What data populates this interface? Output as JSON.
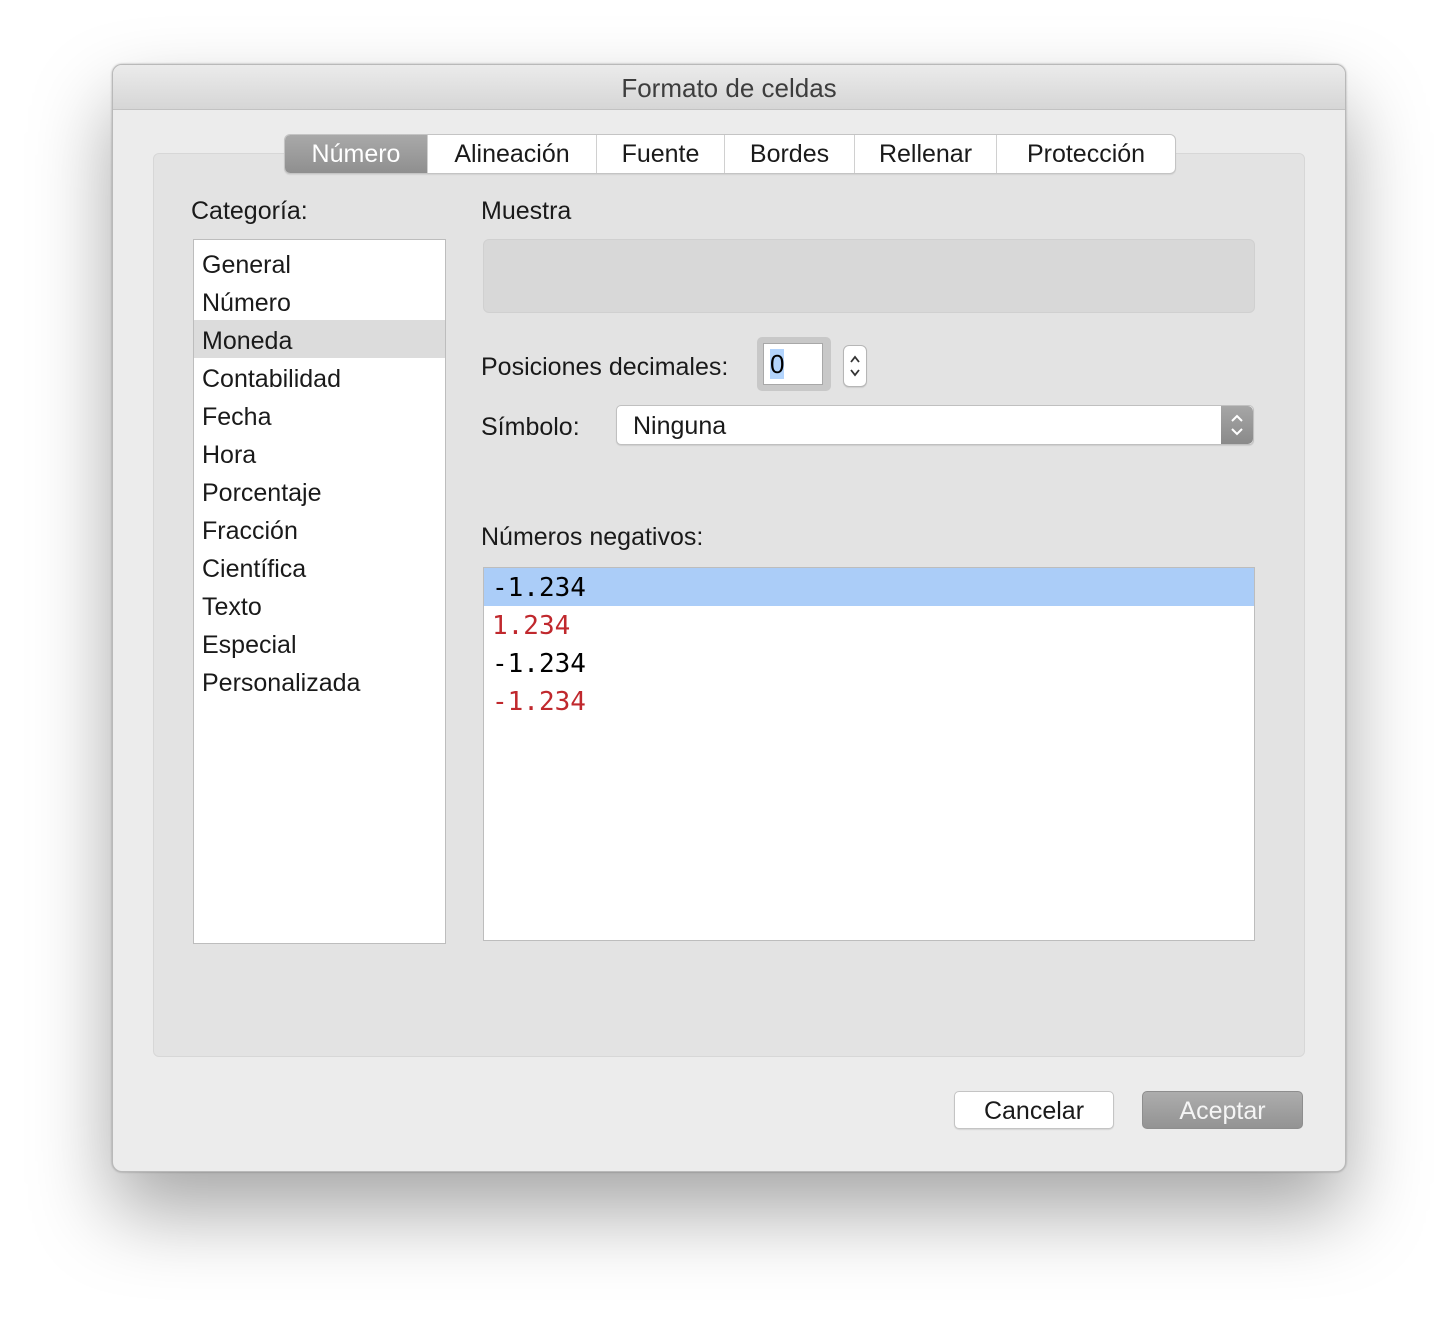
{
  "window": {
    "title": "Formato de celdas"
  },
  "tabs": [
    {
      "label": "Número",
      "active": true
    },
    {
      "label": "Alineación",
      "active": false
    },
    {
      "label": "Fuente",
      "active": false
    },
    {
      "label": "Bordes",
      "active": false
    },
    {
      "label": "Rellenar",
      "active": false
    },
    {
      "label": "Protección",
      "active": false
    }
  ],
  "category": {
    "label": "Categoría:",
    "items": [
      "General",
      "Número",
      "Moneda",
      "Contabilidad",
      "Fecha",
      "Hora",
      "Porcentaje",
      "Fracción",
      "Científica",
      "Texto",
      "Especial",
      "Personalizada"
    ],
    "selected": "Moneda"
  },
  "sample": {
    "label": "Muestra"
  },
  "decimals": {
    "label": "Posiciones decimales:",
    "value": "0"
  },
  "symbol": {
    "label": "Símbolo:",
    "value": "Ninguna"
  },
  "negatives": {
    "label": "Números negativos:",
    "items": [
      {
        "text": "-1.234",
        "color": "#000000",
        "selected": true
      },
      {
        "text": "1.234",
        "color": "#c0282d",
        "selected": false
      },
      {
        "text": "-1.234",
        "color": "#000000",
        "selected": false
      },
      {
        "text": "-1.234",
        "color": "#c0282d",
        "selected": false
      }
    ]
  },
  "buttons": {
    "cancel": "Cancelar",
    "ok": "Aceptar"
  }
}
